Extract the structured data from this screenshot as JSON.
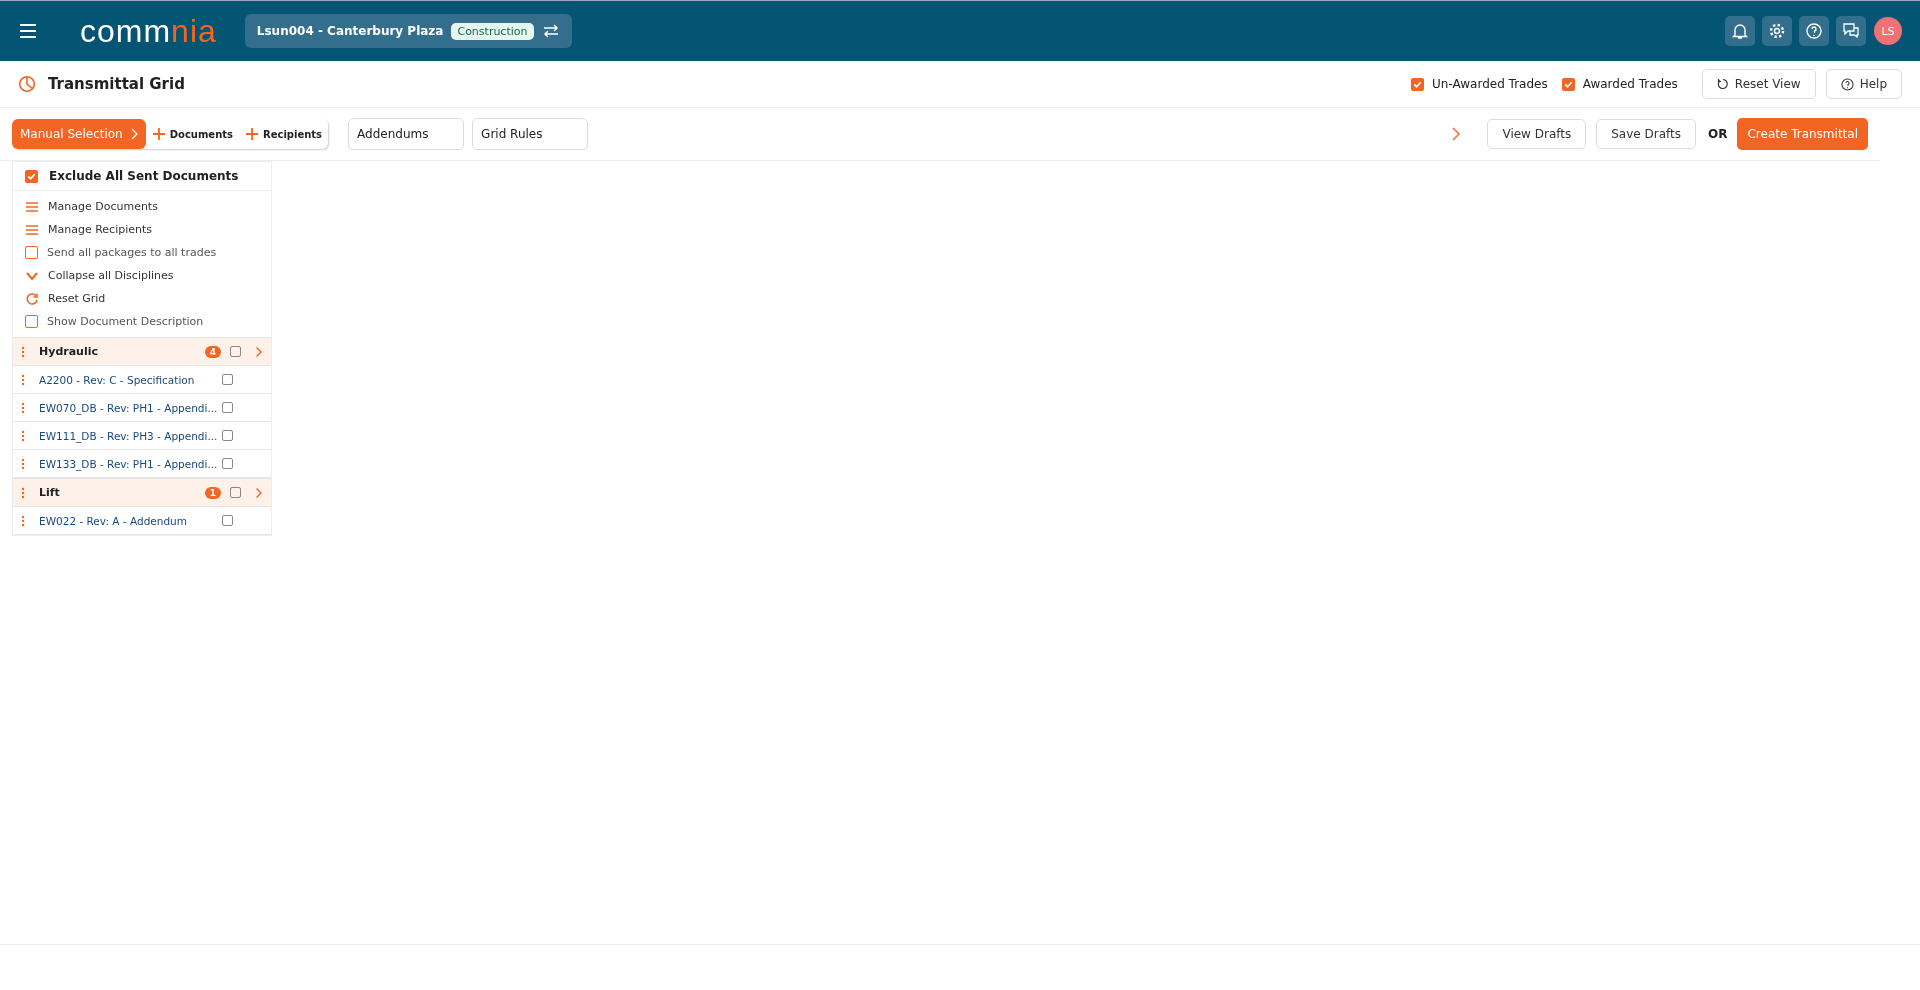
{
  "header": {
    "logo": {
      "main": "comm",
      "accent": "nia"
    },
    "project": {
      "name": "Lsun004 - Canterbury Plaza",
      "stage": "Construction"
    },
    "avatar": "LS"
  },
  "page": {
    "title": "Transmittal Grid",
    "filters": [
      {
        "label": "Un-Awarded Trades",
        "checked": true
      },
      {
        "label": "Awarded Trades",
        "checked": true
      }
    ],
    "buttons": [
      "Reset View",
      "Help"
    ]
  },
  "toolbar": {
    "steps": [
      {
        "label": "Manual Selection",
        "kind": "primary"
      },
      {
        "label": "Documents",
        "kind": "add"
      },
      {
        "label": "Recipients",
        "kind": "add"
      }
    ],
    "tabs": [
      "Addendums",
      "Grid Rules"
    ],
    "actions": {
      "view": "View Drafts",
      "save": "Save Drafts",
      "or": "OR",
      "create": "Create Transmittal"
    }
  },
  "sidebar": {
    "exclude": {
      "label": "Exclude All Sent Documents",
      "checked": true
    },
    "options": [
      {
        "kind": "menu",
        "label": "Manage Documents"
      },
      {
        "kind": "menu",
        "label": "Manage Recipients"
      },
      {
        "kind": "checkbox",
        "label": "Send all packages to all trades",
        "checked": false
      },
      {
        "kind": "collapse",
        "label": "Collapse all Disciplines"
      },
      {
        "kind": "reset",
        "label": "Reset Grid"
      },
      {
        "kind": "checkbox",
        "label": "Show Document Description",
        "checked": false
      }
    ],
    "disciplines": [
      {
        "name": "Hydraulic",
        "count": "4",
        "checked": false,
        "children": [
          {
            "name": "A2200 - Rev: C - Specification",
            "checked": false
          },
          {
            "name": "EW070_DB - Rev: PH1 - Appendi...",
            "checked": false
          },
          {
            "name": "EW111_DB - Rev: PH3 - Appendi...",
            "checked": false
          },
          {
            "name": "EW133_DB - Rev: PH1 - Appendi...",
            "checked": false
          }
        ]
      },
      {
        "name": "Lift",
        "count": "1",
        "checked": false,
        "children": [
          {
            "name": "EW022 - Rev: A - Addendum",
            "checked": false
          }
        ]
      }
    ]
  }
}
